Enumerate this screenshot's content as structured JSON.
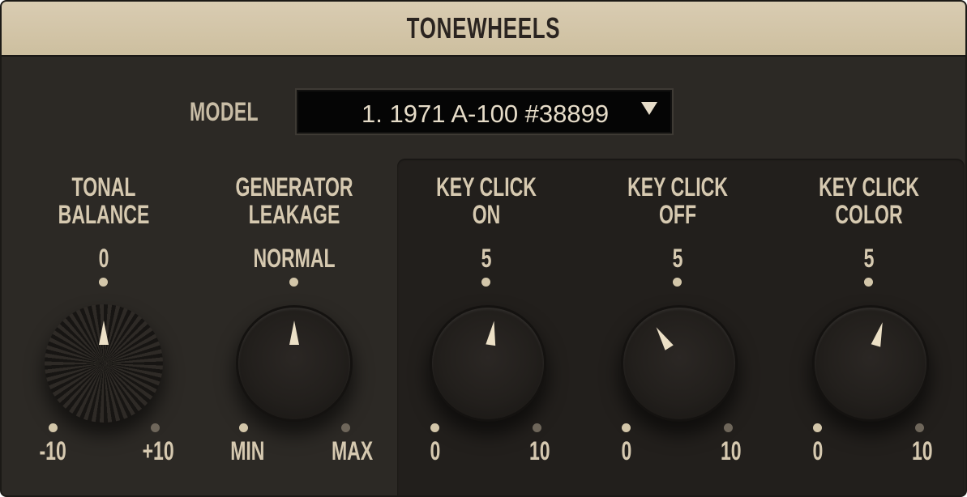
{
  "header": {
    "title": "TONEWHEELS"
  },
  "model": {
    "label": "MODEL",
    "value": "1. 1971 A-100 #38899"
  },
  "knobs": [
    {
      "id": "tonal-balance",
      "line1": "TONAL",
      "line2": "BALANCE",
      "center": "0",
      "min": "-10",
      "max": "+10",
      "level": 0.5
    },
    {
      "id": "generator-leakage",
      "line1": "GENERATOR",
      "line2": "LEAKAGE",
      "center": "NORMAL",
      "min": "MIN",
      "max": "MAX",
      "level": 0.5
    },
    {
      "id": "key-click-on",
      "line1": "KEY CLICK",
      "line2": "ON",
      "center": "5",
      "min": "0",
      "max": "10",
      "level": 0.53
    },
    {
      "id": "key-click-off",
      "line1": "KEY CLICK",
      "line2": "OFF",
      "center": "5",
      "min": "0",
      "max": "10",
      "level": 0.38
    },
    {
      "id": "key-click-color",
      "line1": "KEY CLICK",
      "line2": "COLOR",
      "center": "5",
      "min": "0",
      "max": "10",
      "level": 0.56
    }
  ],
  "colors": {
    "header": "#d5c7aa",
    "panel": "#2c2925",
    "text": "#d6c9b0",
    "pointer": "#ece0c6"
  }
}
